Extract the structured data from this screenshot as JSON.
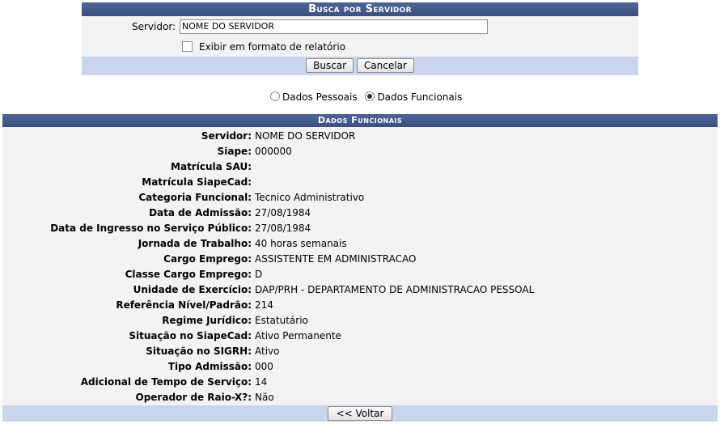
{
  "search": {
    "title": "Busca por Servidor",
    "servidor_label": "Servidor:",
    "servidor_value": "NOME DO SERVIDOR",
    "relatorio_label": "Exibir em formato de relatório",
    "relatorio_checked": false,
    "buscar_label": "Buscar",
    "cancelar_label": "Cancelar"
  },
  "view_options": {
    "selected": "Dados Funcionais",
    "options": [
      {
        "label": "Dados Pessoais",
        "checked": false
      },
      {
        "label": "Dados Funcionais",
        "checked": true
      }
    ]
  },
  "details": {
    "title": "Dados Funcionais",
    "rows": [
      {
        "label": "Servidor:",
        "value": "NOME DO SERVIDOR"
      },
      {
        "label": "Siape:",
        "value": "000000"
      },
      {
        "label": "Matrícula SAU:",
        "value": ""
      },
      {
        "label": "Matrícula SiapeCad:",
        "value": ""
      },
      {
        "label": "Categoria Funcional:",
        "value": "Tecnico Administrativo"
      },
      {
        "label": "Data de Admissão:",
        "value": "27/08/1984"
      },
      {
        "label": "Data de Ingresso no Serviço Público:",
        "value": "27/08/1984"
      },
      {
        "label": "Jornada de Trabalho:",
        "value": "40 horas semanais"
      },
      {
        "label": "Cargo Emprego:",
        "value": "ASSISTENTE EM ADMINISTRACAO"
      },
      {
        "label": "Classe Cargo Emprego:",
        "value": "D"
      },
      {
        "label": "Unidade de Exercício:",
        "value": "DAP/PRH - DEPARTAMENTO DE ADMINISTRACAO PESSOAL"
      },
      {
        "label": "Referência Nível/Padrão:",
        "value": "214"
      },
      {
        "label": "Regime Jurídico:",
        "value": "Estatutário"
      },
      {
        "label": "Situação no SiapeCad:",
        "value": "Ativo Permanente"
      },
      {
        "label": "Situação no SIGRH:",
        "value": "Ativo"
      },
      {
        "label": "Tipo Admissão:",
        "value": "000"
      },
      {
        "label": "Adicional de Tempo de Serviço:",
        "value": "14"
      },
      {
        "label": "Operador de Raio-X?:",
        "value": "Não"
      }
    ],
    "voltar_label": "<< Voltar"
  }
}
